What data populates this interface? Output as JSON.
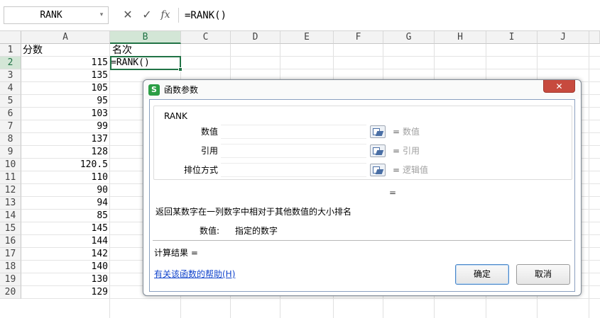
{
  "formula_bar": {
    "name_box": "RANK",
    "cancel_icon": "close-icon",
    "enter_icon": "check-icon",
    "fx_label": "fx",
    "formula": "=RANK()"
  },
  "grid": {
    "columns": [
      "A",
      "B",
      "C",
      "D",
      "E",
      "F",
      "G",
      "H",
      "I",
      "J"
    ],
    "active_column": "B",
    "active_row": "2",
    "rows": [
      {
        "num": "1",
        "a": "分数",
        "b": "名次"
      },
      {
        "num": "2",
        "a": "115",
        "b": "=RANK()"
      },
      {
        "num": "3",
        "a": "135",
        "b": ""
      },
      {
        "num": "4",
        "a": "105",
        "b": ""
      },
      {
        "num": "5",
        "a": "95",
        "b": ""
      },
      {
        "num": "6",
        "a": "103",
        "b": ""
      },
      {
        "num": "7",
        "a": "99",
        "b": ""
      },
      {
        "num": "8",
        "a": "137",
        "b": ""
      },
      {
        "num": "9",
        "a": "128",
        "b": ""
      },
      {
        "num": "10",
        "a": "120.5",
        "b": ""
      },
      {
        "num": "11",
        "a": "110",
        "b": ""
      },
      {
        "num": "12",
        "a": "90",
        "b": ""
      },
      {
        "num": "13",
        "a": "94",
        "b": ""
      },
      {
        "num": "14",
        "a": "85",
        "b": ""
      },
      {
        "num": "15",
        "a": "145",
        "b": ""
      },
      {
        "num": "16",
        "a": "144",
        "b": ""
      },
      {
        "num": "17",
        "a": "142",
        "b": ""
      },
      {
        "num": "18",
        "a": "140",
        "b": ""
      },
      {
        "num": "19",
        "a": "130",
        "b": ""
      },
      {
        "num": "20",
        "a": "129",
        "b": ""
      }
    ],
    "accent_color": "#217346"
  },
  "dialog": {
    "title": "函数参数",
    "logo": "S",
    "close_label": "✕",
    "function_name": "RANK",
    "args": [
      {
        "label": "数值",
        "value": "",
        "eq": "=",
        "hint": "数值"
      },
      {
        "label": "引用",
        "value": "",
        "eq": "=",
        "hint": "引用"
      },
      {
        "label": "排位方式",
        "value": "",
        "eq": "=",
        "hint": "逻辑值"
      }
    ],
    "result_eq": "=",
    "description": "返回某数字在一列数字中相对于其他数值的大小排名",
    "param_name": "数值:",
    "param_desc": "指定的数字",
    "result_label": "计算结果 =",
    "help_link": "有关该函数的帮助(H)",
    "ok_label": "确定",
    "cancel_label": "取消"
  }
}
